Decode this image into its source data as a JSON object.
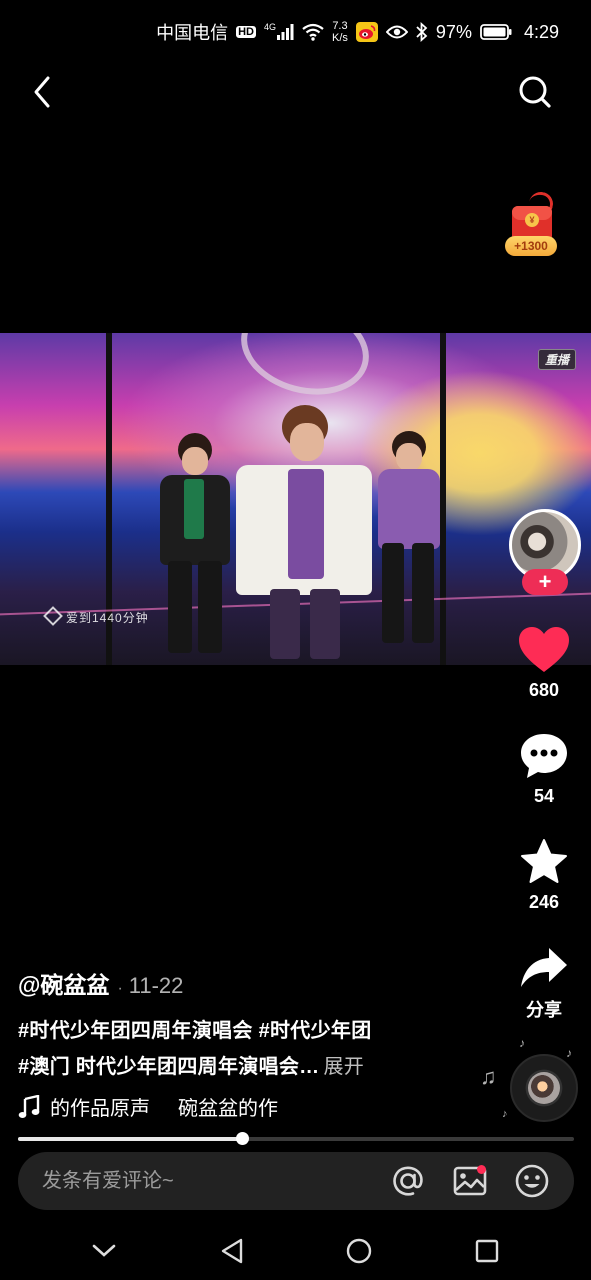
{
  "status_bar": {
    "carrier": "中国电信",
    "hd_badge": "HD",
    "network": "4G",
    "speed_value": "7.3",
    "speed_unit": "K/s",
    "battery": "97%",
    "time": "4:29",
    "icons": [
      "signal-icon",
      "wifi-icon",
      "weibo-icon",
      "eye-icon",
      "bluetooth-icon",
      "battery-icon"
    ]
  },
  "top_nav": {
    "back_icon": "chevron-left-icon",
    "search_icon": "search-icon"
  },
  "red_packet": {
    "amount": "+1300",
    "coin_symbol": "¥"
  },
  "video": {
    "replay_tag": "重播",
    "channel_tag": "爱到1440分钟"
  },
  "actions": {
    "follow_symbol": "+",
    "like_count": "680",
    "comment_count": "54",
    "favorite_count": "246",
    "share_label": "分享"
  },
  "post": {
    "author": "@碗盆盆",
    "separator": "·",
    "date": "11-22",
    "caption_line1": "#时代少年团四周年演唱会 #时代少年团",
    "caption_line2": "#澳门 时代少年团四周年演唱会…",
    "expand_label": "展开",
    "music_text_1": "的作品原声",
    "music_text_2": "碗盆盆的作"
  },
  "playback": {
    "progress_fraction": 0.402
  },
  "comment_bar": {
    "placeholder": "发条有爱评论~",
    "icons": [
      "at-icon",
      "image-icon",
      "emoji-icon"
    ]
  },
  "nav_bar": {
    "icons": [
      "nav-back-icon",
      "nav-home-icon",
      "nav-recents-icon"
    ]
  },
  "colors": {
    "accent": "#ee2d56",
    "like": "#fe2c55",
    "background": "#000000"
  }
}
